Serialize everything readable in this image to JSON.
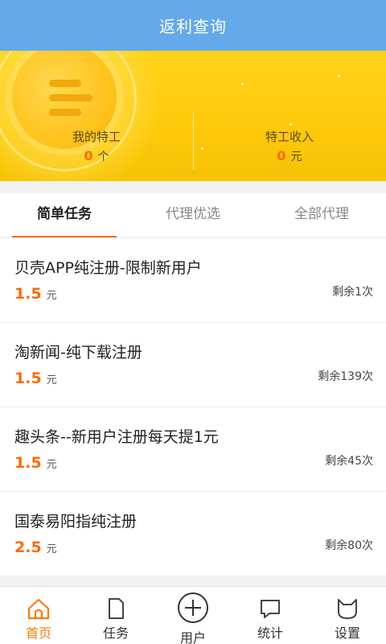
{
  "header": {
    "title": "返利查询"
  },
  "summary": {
    "agents_label": "我的特工",
    "agents_value": "0",
    "agents_unit": "个",
    "income_label": "特工收入",
    "income_value": "0",
    "income_unit": "元"
  },
  "tabs": [
    {
      "label": "简单任务",
      "active": true
    },
    {
      "label": "代理优选",
      "active": false
    },
    {
      "label": "全部代理",
      "active": false
    }
  ],
  "tasks": [
    {
      "title": "贝壳APP纯注册-限制新用户",
      "price": "1.5",
      "unit": "元",
      "remaining": "剩余1次"
    },
    {
      "title": "淘新闻-纯下载注册",
      "price": "1.5",
      "unit": "元",
      "remaining": "剩余139次"
    },
    {
      "title": "趣头条--新用户注册每天提1元",
      "price": "1.5",
      "unit": "元",
      "remaining": "剩余45次"
    },
    {
      "title": "国泰易阳指纯注册",
      "price": "2.5",
      "unit": "元",
      "remaining": "剩余80次"
    }
  ],
  "bottom_nav": [
    {
      "label": "首页",
      "icon": "home-icon",
      "active": true
    },
    {
      "label": "任务",
      "icon": "document-icon",
      "active": false
    },
    {
      "label": "用户",
      "icon": "plus-circle-icon",
      "active": false
    },
    {
      "label": "统计",
      "icon": "chat-bubble-icon",
      "active": false
    },
    {
      "label": "设置",
      "icon": "cat-icon",
      "active": false
    }
  ],
  "colors": {
    "header": "#64a9ea",
    "accent": "#ff6a00",
    "banner": "#ffc90a"
  }
}
